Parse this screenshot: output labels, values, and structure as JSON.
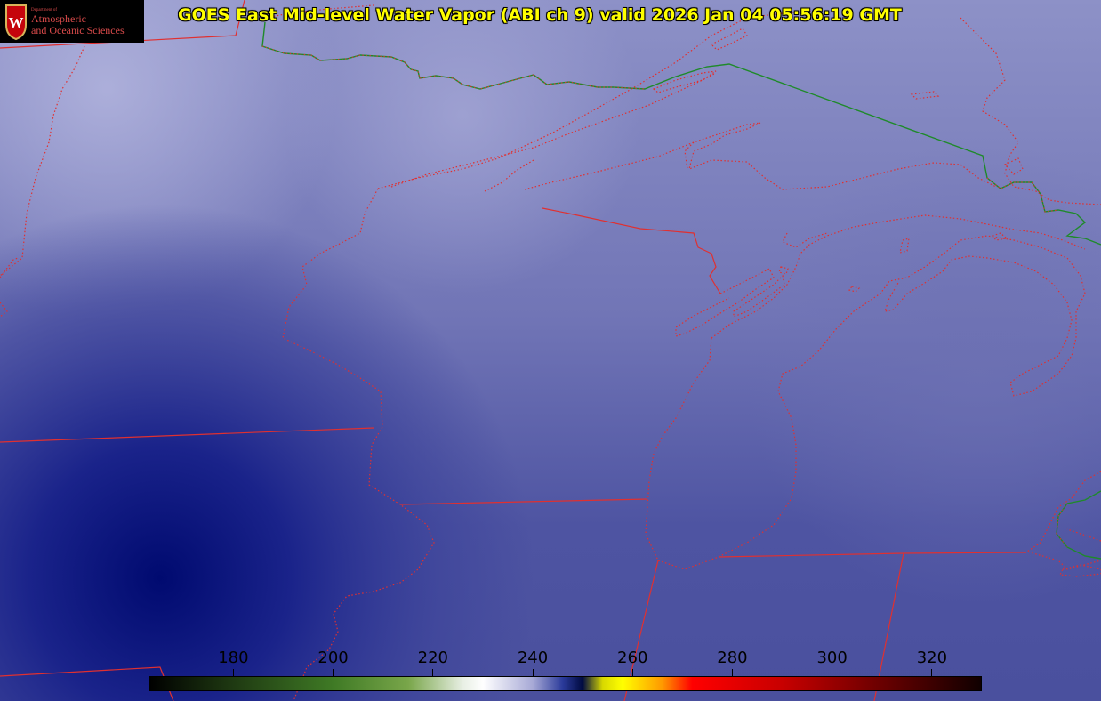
{
  "title": "GOES East Mid-level Water Vapor (ABI ch 9)  valid 2026 Jan 04 05:56:19 GMT",
  "logo": {
    "department": "Department of",
    "line1": "Atmospheric",
    "line2": "and Oceanic Sciences",
    "crest_letter": "W"
  },
  "colors": {
    "title": "#ffff00",
    "state_borders": "#e03030",
    "international_border": "#1f8a2a",
    "background_moist": "#8e92c8",
    "background_dry": "#0a1478"
  },
  "colorbar": {
    "min": 163,
    "max": 330,
    "ticks": [
      {
        "value": 180,
        "label": "180"
      },
      {
        "value": 200,
        "label": "200"
      },
      {
        "value": 220,
        "label": "220"
      },
      {
        "value": 240,
        "label": "240"
      },
      {
        "value": 260,
        "label": "260"
      },
      {
        "value": 280,
        "label": "280"
      },
      {
        "value": 300,
        "label": "300"
      },
      {
        "value": 320,
        "label": "320"
      }
    ],
    "stops": [
      {
        "value": 163,
        "color": "#000000"
      },
      {
        "value": 180,
        "color": "#1f3a12"
      },
      {
        "value": 200,
        "color": "#3f7a25"
      },
      {
        "value": 215,
        "color": "#79a64a"
      },
      {
        "value": 226,
        "color": "#e8efe4"
      },
      {
        "value": 230,
        "color": "#ffffff"
      },
      {
        "value": 240,
        "color": "#a7a9d6"
      },
      {
        "value": 246,
        "color": "#2a3a9a"
      },
      {
        "value": 250,
        "color": "#000a40"
      },
      {
        "value": 254,
        "color": "#d8d800"
      },
      {
        "value": 258,
        "color": "#ffff00"
      },
      {
        "value": 266,
        "color": "#ff9900"
      },
      {
        "value": 272,
        "color": "#ff0000"
      },
      {
        "value": 290,
        "color": "#c80000"
      },
      {
        "value": 310,
        "color": "#6a0000"
      },
      {
        "value": 330,
        "color": "#100000"
      }
    ]
  }
}
